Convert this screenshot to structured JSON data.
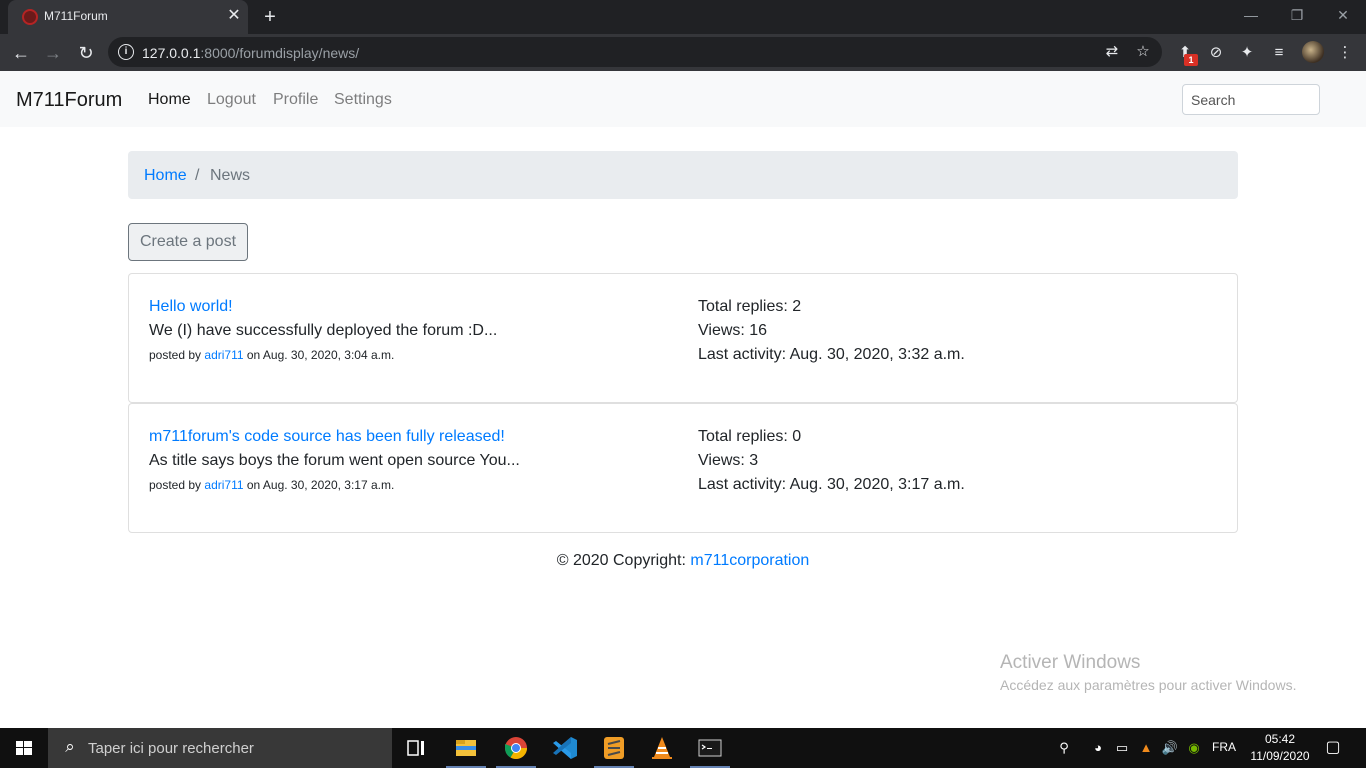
{
  "browser": {
    "tab_title": "M711Forum",
    "url_host": "127.0.0.1",
    "url_path": ":8000/forumdisplay/news/",
    "extension_badge": "1"
  },
  "navbar": {
    "brand": "M711Forum",
    "links": [
      "Home",
      "Logout",
      "Profile",
      "Settings"
    ],
    "search_placeholder": "Search"
  },
  "breadcrumb": {
    "home": "Home",
    "separator": "/",
    "current": "News"
  },
  "create_post_label": "Create a post",
  "posts": [
    {
      "title": "Hello world!",
      "excerpt": "We (I) have successfully deployed the forum :D...",
      "posted_by_prefix": "posted by",
      "author": "adri711",
      "date": "on Aug. 30, 2020, 3:04 a.m.",
      "total_replies": "Total replies: 2",
      "views": "Views: 16",
      "last_activity": "Last activity: Aug. 30, 2020, 3:32 a.m."
    },
    {
      "title": "m711forum's code source has been fully released!",
      "excerpt": "As title says boys the forum went open source You...",
      "posted_by_prefix": "posted by",
      "author": "adri711",
      "date": "on Aug. 30, 2020, 3:17 a.m.",
      "total_replies": "Total replies: 0",
      "views": "Views: 3",
      "last_activity": "Last activity: Aug. 30, 2020, 3:17 a.m."
    }
  ],
  "footer": {
    "text": "© 2020 Copyright:",
    "link": "m711corporation"
  },
  "watermark": {
    "title": "Activer Windows",
    "subtitle": "Accédez aux paramètres pour activer Windows."
  },
  "taskbar": {
    "search_placeholder": "Taper ici pour rechercher",
    "language": "FRA",
    "time": "05:42",
    "date": "11/09/2020"
  },
  "colors": {
    "link": "#007bff",
    "navbar_bg": "#f8f9fa",
    "breadcrumb_bg": "#e9ecef",
    "chrome_dark": "#202124",
    "chrome_toolbar": "#35363a"
  }
}
